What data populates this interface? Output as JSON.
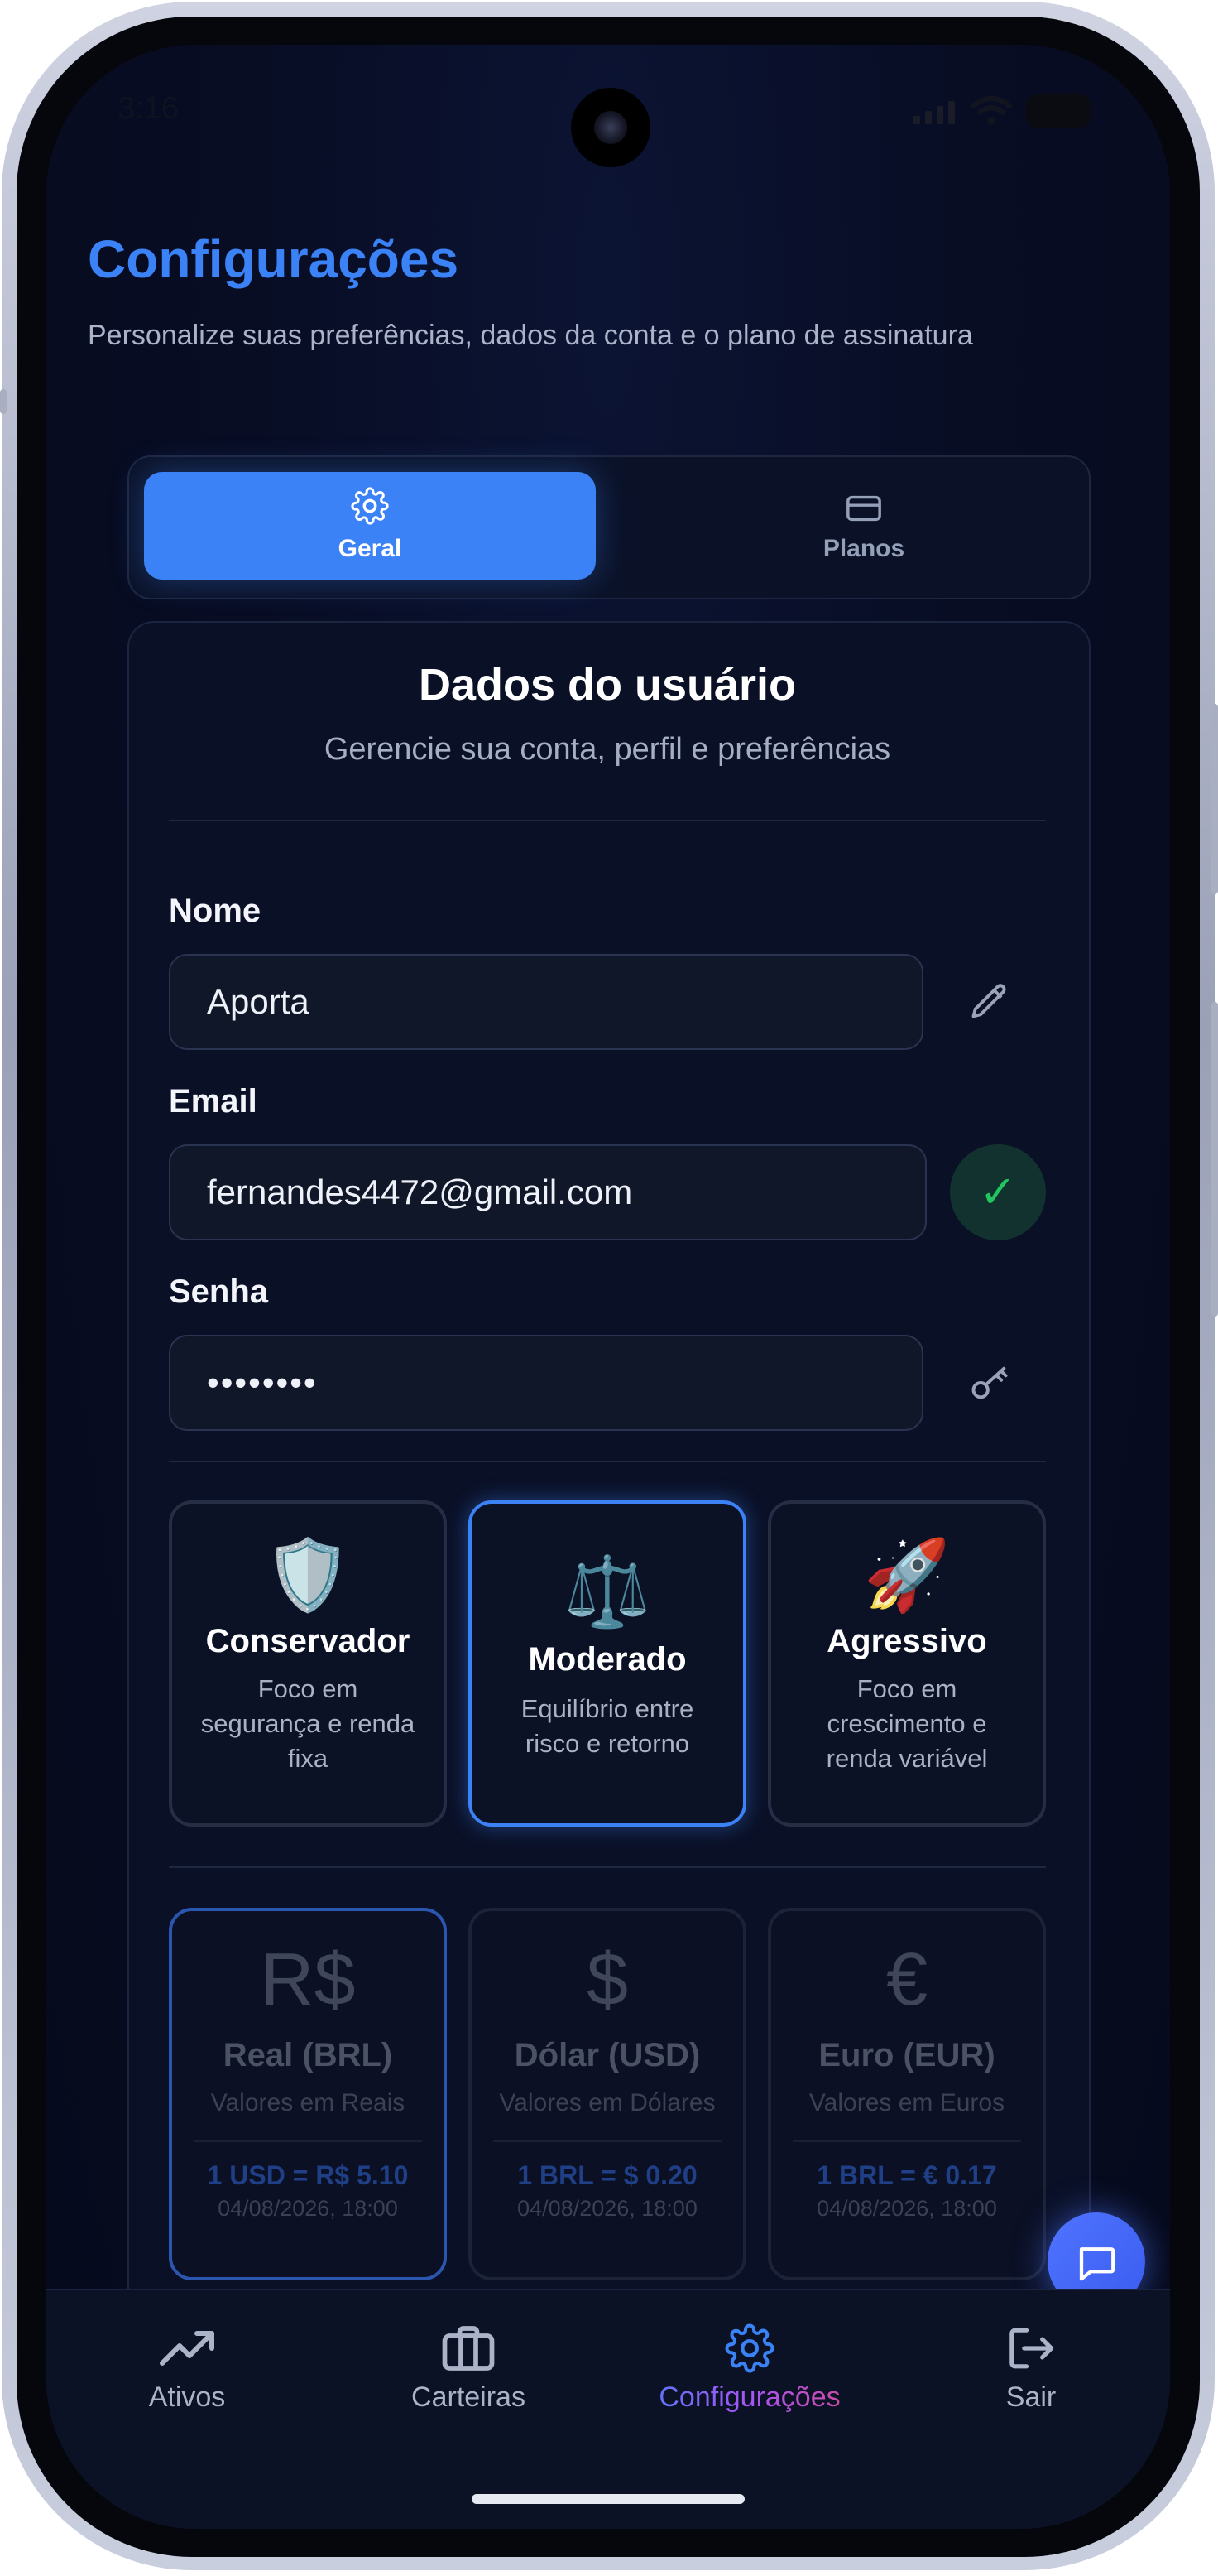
{
  "status_bar": {
    "time": "3:16"
  },
  "header": {
    "title": "Configurações",
    "subtitle": "Personalize suas preferências, dados da conta e o plano de assinatura"
  },
  "tabs": [
    {
      "label": "Geral",
      "icon": "gear-icon",
      "active": true
    },
    {
      "label": "Planos",
      "icon": "card-icon",
      "active": false
    }
  ],
  "user_card": {
    "title": "Dados do usuário",
    "subtitle": "Gerencie sua conta, perfil e preferências"
  },
  "form": {
    "name_label": "Nome",
    "name_value": "Aporta",
    "email_label": "Email",
    "email_value": "fernandes4472@gmail.com",
    "password_label": "Senha",
    "password_value": "••••••••"
  },
  "profiles": [
    {
      "icon": "🛡️",
      "title": "Conservador",
      "desc": "Foco em segurança e renda fixa",
      "selected": false
    },
    {
      "icon": "⚖️",
      "title": "Moderado",
      "desc": "Equilíbrio entre risco e retorno",
      "selected": true
    },
    {
      "icon": "🚀",
      "title": "Agressivo",
      "desc": "Foco em crescimento e renda variável",
      "selected": false
    }
  ],
  "currencies": [
    {
      "symbol": "R$",
      "name": "Real (BRL)",
      "desc": "Valores em Reais",
      "rate": "1 USD = R$ 5.10",
      "date": "04/08/2026, 18:00",
      "selected": true
    },
    {
      "symbol": "$",
      "name": "Dólar (USD)",
      "desc": "Valores em Dólares",
      "rate": "1 BRL = $ 0.20",
      "date": "04/08/2026, 18:00",
      "selected": false
    },
    {
      "symbol": "€",
      "name": "Euro (EUR)",
      "desc": "Valores em Euros",
      "rate": "1 BRL = € 0.17",
      "date": "04/08/2026, 18:00",
      "selected": false
    }
  ],
  "nav": [
    {
      "label": "Ativos",
      "icon": "trending-up-icon"
    },
    {
      "label": "Carteiras",
      "icon": "briefcase-icon"
    },
    {
      "label": "Configurações",
      "icon": "gear-icon",
      "active": true
    },
    {
      "label": "Sair",
      "icon": "logout-icon"
    }
  ],
  "colors": {
    "accent": "#3b82f6",
    "background": "#080d24",
    "success": "#22c55e"
  }
}
